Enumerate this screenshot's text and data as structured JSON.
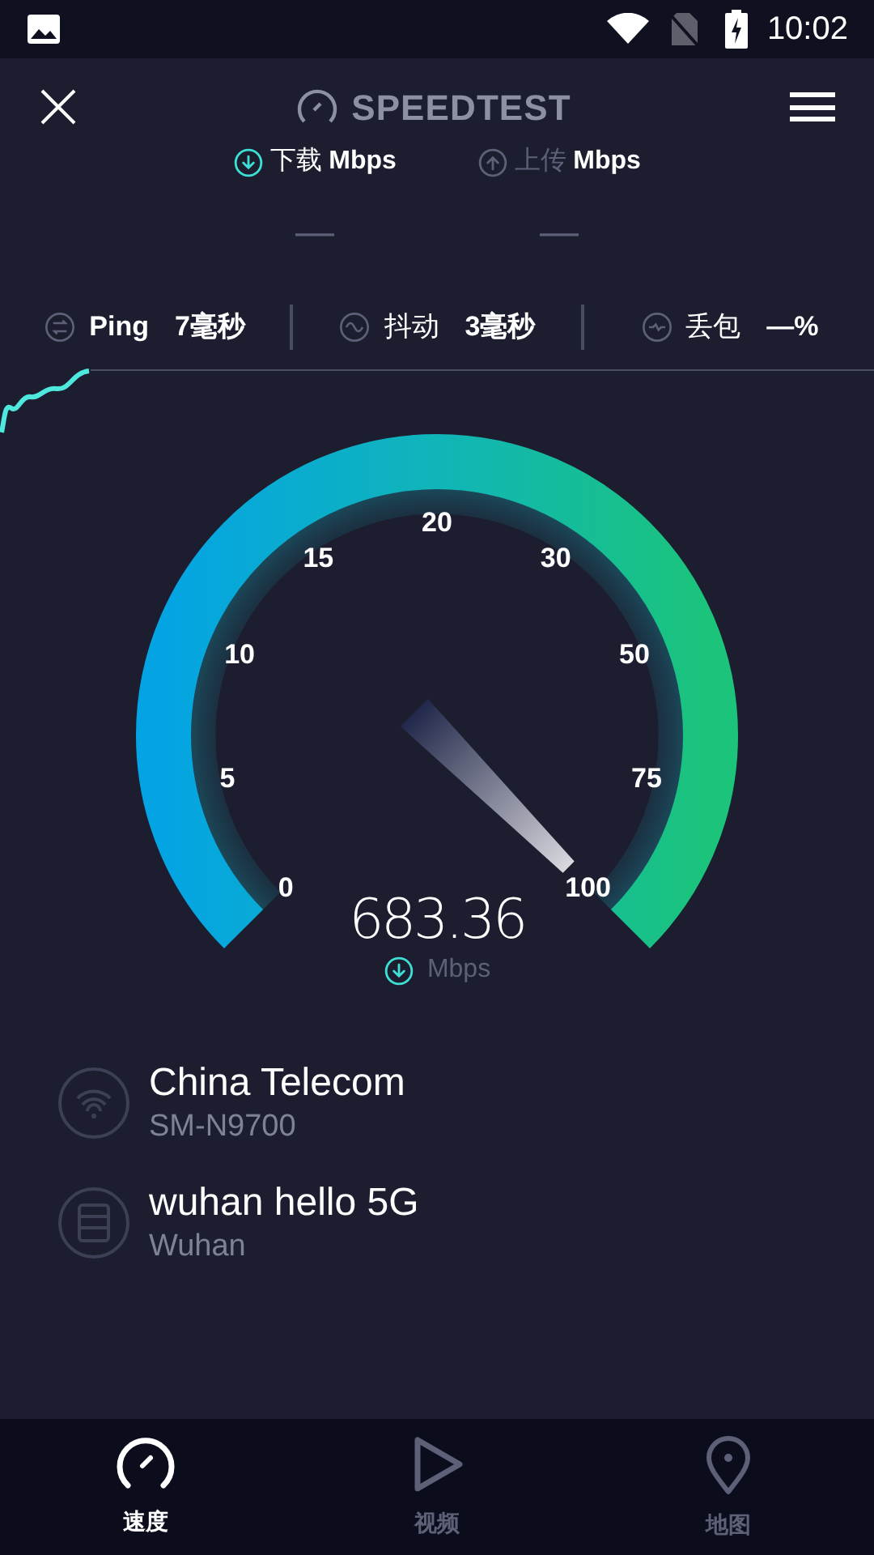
{
  "status_bar": {
    "time": "10:02"
  },
  "header": {
    "title": "SPEEDTEST"
  },
  "modes": [
    {
      "label": "下载",
      "unit": "Mbps",
      "kind": "download",
      "selected": true,
      "value": "—"
    },
    {
      "label": "上传",
      "unit": "Mbps",
      "kind": "upload",
      "selected": false,
      "value": "—"
    }
  ],
  "stats": [
    {
      "kind": "ping",
      "label": "Ping",
      "value": "7毫秒"
    },
    {
      "kind": "jitter",
      "label": "抖动",
      "value": "3毫秒"
    },
    {
      "kind": "loss",
      "label": "丢包",
      "value": "—%"
    }
  ],
  "gauge": {
    "ticks": [
      "0",
      "5",
      "10",
      "15",
      "20",
      "30",
      "50",
      "75",
      "100"
    ],
    "reading": "683.36",
    "unit": "Mbps"
  },
  "connections": [
    {
      "kind": "network",
      "title": "China Telecom",
      "subtitle": "SM-N9700"
    },
    {
      "kind": "server",
      "title": "wuhan hello 5G",
      "subtitle": "Wuhan"
    }
  ],
  "nav": [
    {
      "kind": "speed",
      "label": "速度",
      "selected": true
    },
    {
      "kind": "video",
      "label": "视频",
      "selected": false
    },
    {
      "kind": "map",
      "label": "地图",
      "selected": false
    }
  ]
}
